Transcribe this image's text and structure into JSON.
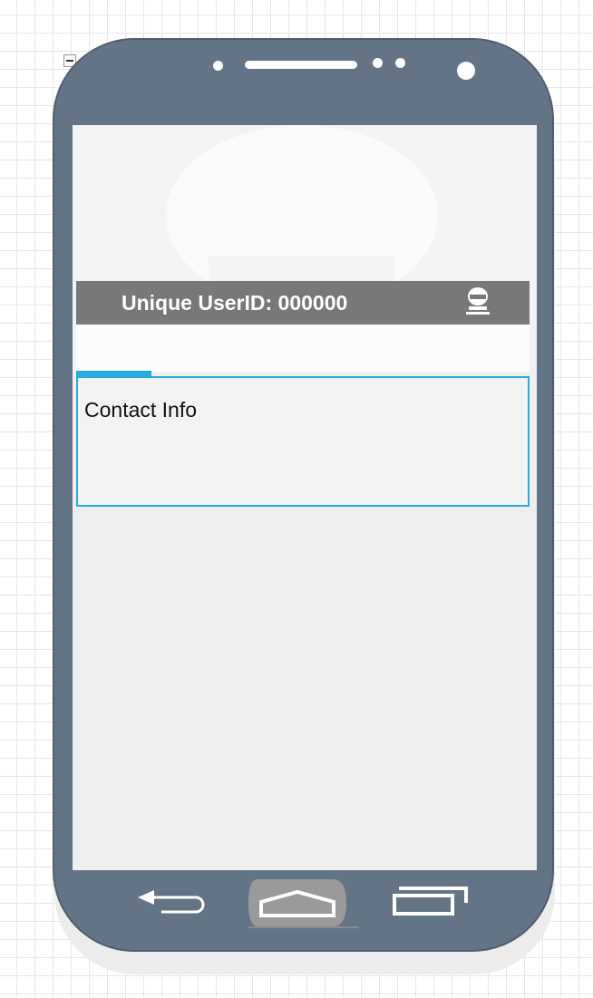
{
  "header": {
    "user_id_label": "Unique UserID: 000000"
  },
  "contact": {
    "title": "Contact Info"
  },
  "icons": {
    "user": "user-icon",
    "back": "back-arrow-icon",
    "home": "home-icon",
    "recent": "recent-apps-icon",
    "collapse": "minus-icon"
  },
  "colors": {
    "phone_body": "#647487",
    "header_bar": "#787878",
    "accent": "#29abe2",
    "screen_bg": "#efefef"
  }
}
